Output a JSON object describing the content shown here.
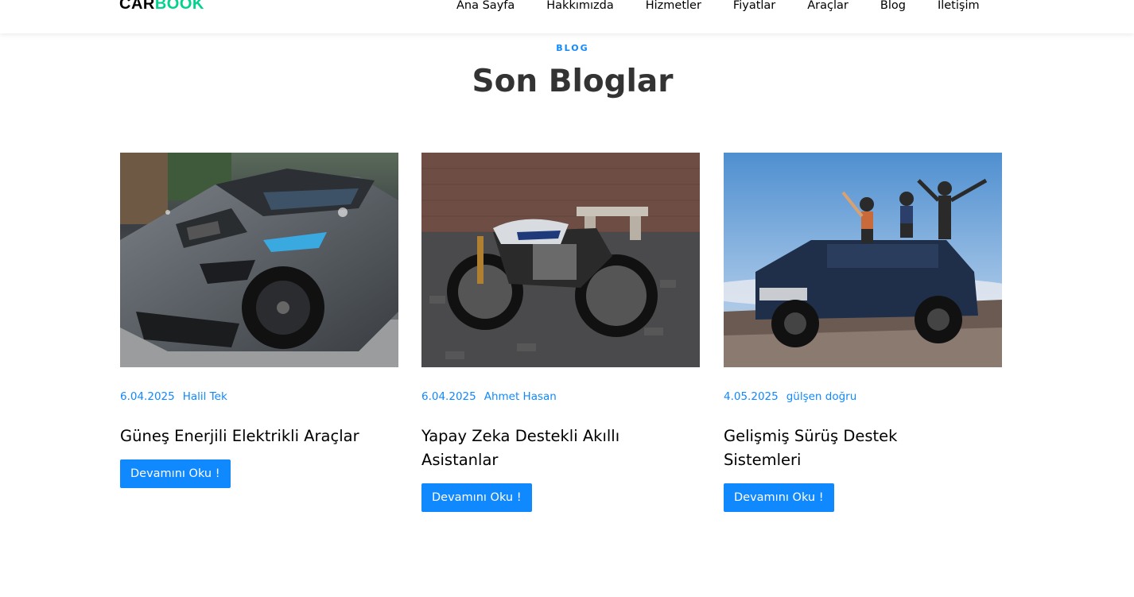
{
  "brand": {
    "part1": "CAR",
    "part2": "BOOK",
    "accent_color": "#01d28e"
  },
  "nav": {
    "items": [
      "Ana Sayfa",
      "Hakkımızda",
      "Hizmetler",
      "Fiyatlar",
      "Araçlar",
      "Blog",
      "İletişim"
    ]
  },
  "section": {
    "subheading": "BLOG",
    "heading": "Son Bloglar",
    "accent_color": "#1089ff"
  },
  "posts": [
    {
      "date": "6.04.2025",
      "author": "Halil Tek",
      "title": "Güneş Enerjili Elektrikli Araçlar",
      "button": "Devamını Oku !",
      "image": "grey-sports-car-photo"
    },
    {
      "date": "6.04.2025",
      "author": "Ahmet Hasan",
      "title": "Yapay Zeka Destekli Akıllı Asistanlar",
      "button": "Devamını Oku !",
      "image": "cafe-racer-motorcycle-photo"
    },
    {
      "date": "4.05.2025",
      "author": "gülşen doğru",
      "title": "Gelişmiş Sürüş Destek Sistemleri",
      "button": "Devamını Oku !",
      "image": "offroad-truck-with-friends-photo"
    }
  ]
}
